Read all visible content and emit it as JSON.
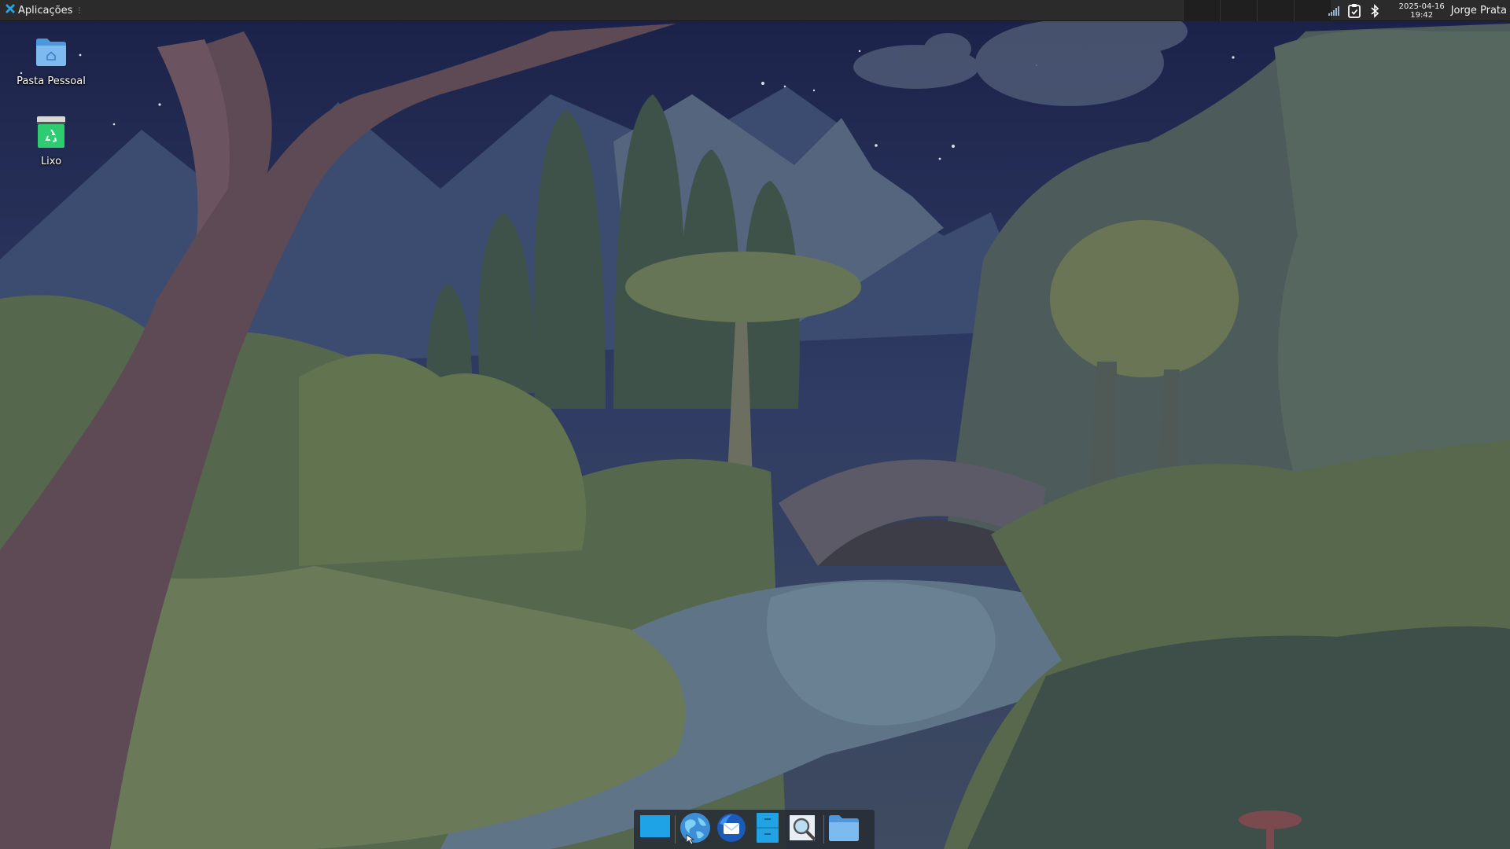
{
  "top_panel": {
    "apps_menu_label": "Aplicações",
    "clock": {
      "date": "2025-04-16",
      "time": "19:42"
    },
    "username": "Jorge Prata",
    "tray_icons": [
      "network-signal-icon",
      "clipboard-icon",
      "bluetooth-icon"
    ]
  },
  "desktop": {
    "icons": [
      {
        "label": "Pasta Pessoal",
        "icon": "home-folder-icon"
      },
      {
        "label": "Lixo",
        "icon": "trash-icon"
      }
    ]
  },
  "dock": {
    "items": [
      {
        "icon": "show-desktop-icon"
      },
      {
        "icon": "web-browser-icon"
      },
      {
        "icon": "email-client-icon"
      },
      {
        "icon": "file-cabinet-icon"
      },
      {
        "icon": "search-icon"
      },
      {
        "icon": "folder-icon"
      }
    ]
  },
  "colors": {
    "panel_bg": "#2b2b2b",
    "accent_blue": "#29a3e0",
    "folder_blue": "#6fb4ec",
    "trash_green": "#2ecc71"
  }
}
